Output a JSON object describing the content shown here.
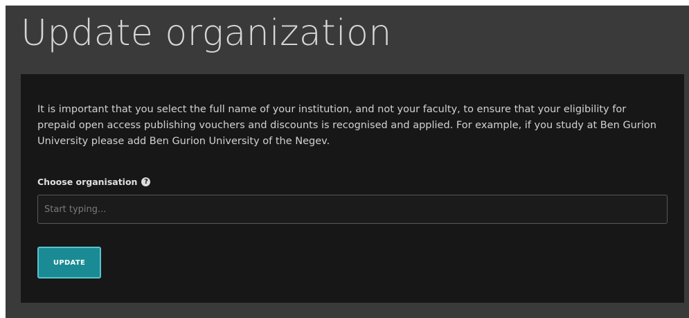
{
  "page": {
    "title": "Update organization"
  },
  "panel": {
    "intro_text": "It is important that you select the full name of your institution, and not your faculty, to ensure that your eligibility for prepaid open access publishing vouchers and discounts is recognised and applied. For example, if you study at Ben Gurion University please add Ben Gurion University of the Negev.",
    "field_label": "Choose organisation",
    "help_icon_glyph": "?",
    "input_value": "",
    "input_placeholder": "Start typing...",
    "update_label": "UPDATE"
  },
  "icons": {
    "help": "question-circle-icon"
  },
  "colors": {
    "frame_background": "#3a3a3a",
    "panel_background": "#171717",
    "button_background": "#1a8b94",
    "button_border": "#5cc3ca",
    "title_text": "#d6d6d6"
  }
}
